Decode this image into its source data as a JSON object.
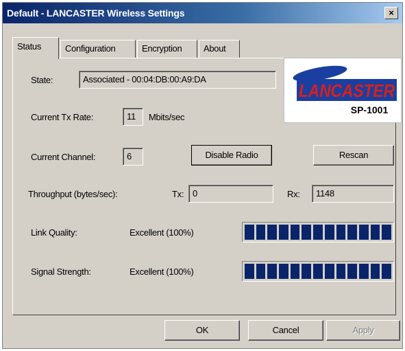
{
  "window": {
    "title": "Default - LANCASTER Wireless Settings",
    "close_glyph": "×"
  },
  "tabs": [
    {
      "label": "Status",
      "active": true
    },
    {
      "label": "Configuration",
      "active": false
    },
    {
      "label": "Encryption",
      "active": false
    },
    {
      "label": "About",
      "active": false
    }
  ],
  "status": {
    "state_label": "State:",
    "state_value": "Associated - 00:04:DB:00:A9:DA",
    "tx_rate_label": "Current Tx Rate:",
    "tx_rate_value": "11",
    "tx_rate_unit": "Mbits/sec",
    "channel_label": "Current Channel:",
    "channel_value": "6",
    "disable_radio_label": "Disable Radio",
    "rescan_label": "Rescan",
    "throughput_label": "Throughput (bytes/sec):",
    "tx_label": "Tx:",
    "tx_value": "0",
    "rx_label": "Rx:",
    "rx_value": "1148",
    "link_quality_label": "Link Quality:",
    "link_quality_value": "Excellent (100%)",
    "link_quality_level": 1.0,
    "signal_strength_label": "Signal Strength:",
    "signal_strength_value": "Excellent (100%)",
    "signal_strength_level": 1.0
  },
  "logo": {
    "brand": "LANCASTER",
    "model": "SP-1001",
    "colors": {
      "blue": "#1b3fa0",
      "red": "#d8201a"
    }
  },
  "footer": {
    "ok_label": "OK",
    "cancel_label": "Cancel",
    "apply_label": "Apply"
  }
}
